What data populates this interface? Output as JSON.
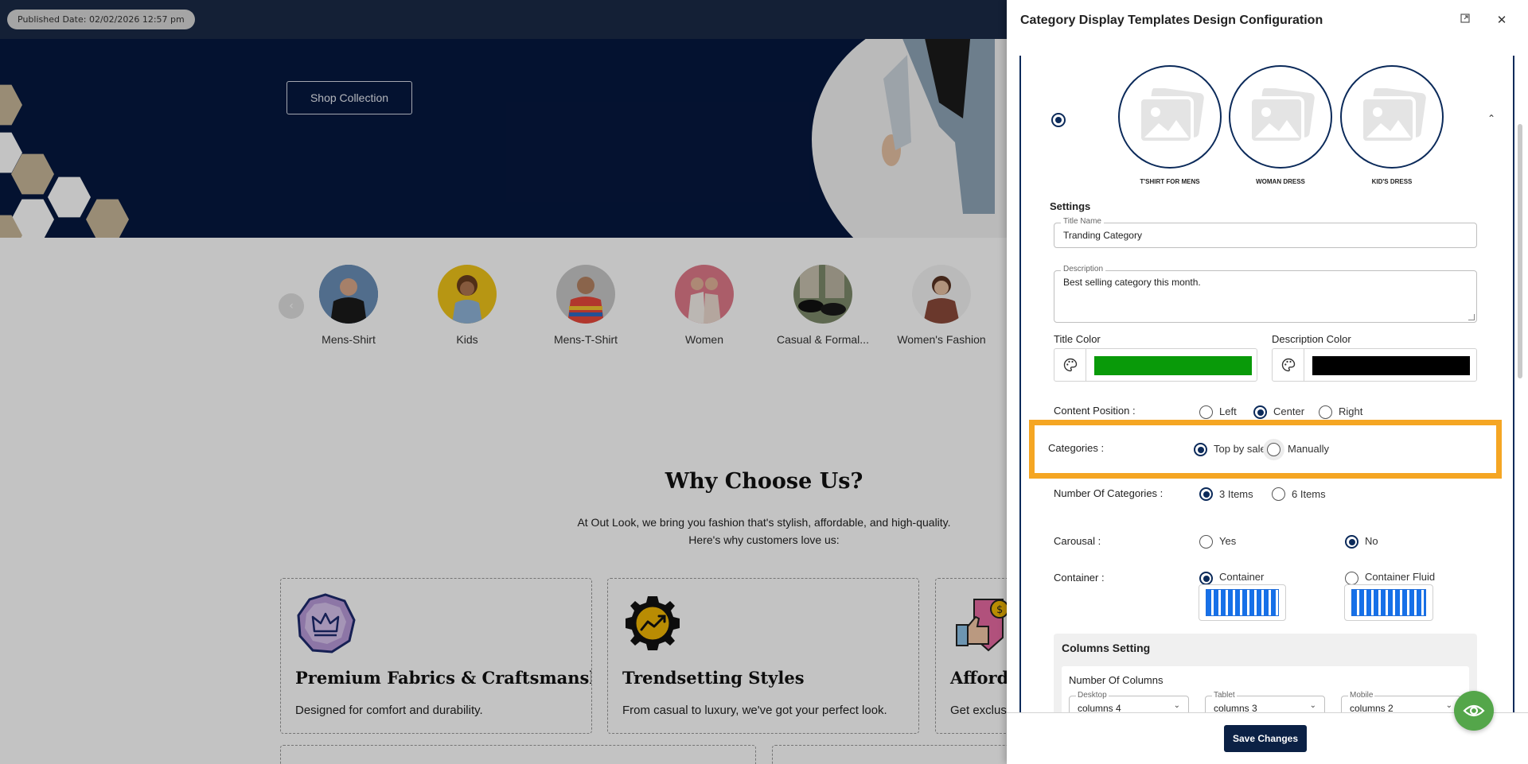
{
  "header": {
    "published_date": "Published Date: 02/02/2026 12:57 pm"
  },
  "hero": {
    "shop_button": "Shop Collection"
  },
  "categories": [
    {
      "label": "Mens-Shirt"
    },
    {
      "label": "Kids"
    },
    {
      "label": "Mens-T-Shirt"
    },
    {
      "label": "Women"
    },
    {
      "label": "Casual & Formal..."
    },
    {
      "label": "Women's Fashion"
    }
  ],
  "why": {
    "title": "Why Choose Us?",
    "subtitle_line1": "At Out Look, we bring you fashion that's stylish, affordable, and high-quality.",
    "subtitle_line2": "Here's why customers love us:",
    "features": [
      {
        "title": "Premium Fabrics & Craftsmanship",
        "desc": "Designed for comfort and durability."
      },
      {
        "title": "Trendsetting Styles",
        "desc": "From casual to luxury, we've got your perfect look."
      },
      {
        "title": "Afforda",
        "desc": "Get exclus"
      }
    ]
  },
  "drawer": {
    "title": "Category Display Templates Design Configuration",
    "preview_items": [
      {
        "label": "T'SHIRT FOR MENS"
      },
      {
        "label": "WOMAN DRESS"
      },
      {
        "label": "KID'S DRESS"
      }
    ],
    "settings_heading": "Settings",
    "title_name": {
      "label": "Title Name",
      "value": "Tranding Category"
    },
    "description": {
      "label": "Description",
      "value": "Best selling category this month."
    },
    "title_color": {
      "label": "Title Color",
      "value": "#099a09"
    },
    "description_color": {
      "label": "Description Color",
      "value": "#000000"
    },
    "content_position": {
      "label": "Content Position :",
      "options": [
        "Left",
        "Center",
        "Right"
      ],
      "selected": "Center"
    },
    "categories_source": {
      "label": "Categories :",
      "options": [
        "Top by sales",
        "Manually"
      ],
      "selected": "Top by sales"
    },
    "number_of_categories": {
      "label": "Number Of Categories :",
      "options": [
        "3 Items",
        "6 Items"
      ],
      "selected": "3 Items"
    },
    "carousel": {
      "label": "Carousal :",
      "options": [
        "Yes",
        "No"
      ],
      "selected": "No"
    },
    "container": {
      "label": "Container :",
      "options": [
        "Container",
        "Container Fluid"
      ],
      "selected": "Container"
    },
    "columns": {
      "heading": "Columns Setting",
      "sub": "Number Of Columns",
      "desktop": {
        "label": "Desktop",
        "value": "columns 4"
      },
      "tablet": {
        "label": "Tablet",
        "value": "columns 3"
      },
      "mobile": {
        "label": "Mobile",
        "value": "columns 2"
      }
    },
    "save_label": "Save Changes"
  },
  "colors": {
    "accent": "#0b2a5a",
    "highlight": "#f5a623",
    "fab": "#54a64a"
  }
}
